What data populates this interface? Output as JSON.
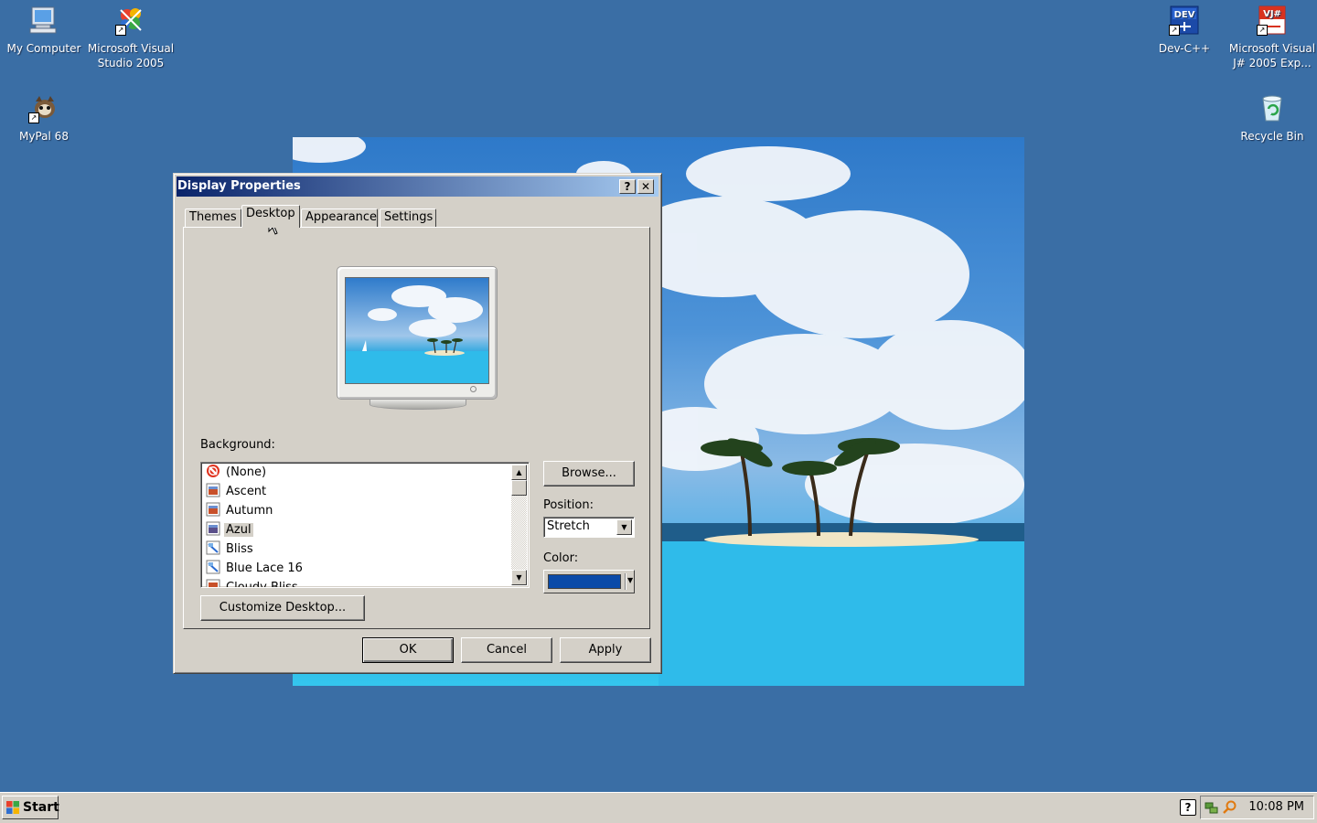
{
  "desktop": {
    "icons_left": [
      {
        "label": "My Computer",
        "icon": "my-computer-icon"
      },
      {
        "label": "Microsoft Visual Studio 2005",
        "icon": "visual-studio-icon"
      },
      {
        "label": "MyPal 68",
        "icon": "mypal-icon"
      }
    ],
    "icons_right": [
      {
        "label": "Dev-C++",
        "icon": "devcpp-icon",
        "badge": "DEV"
      },
      {
        "label": "Microsoft Visual J# 2005 Exp...",
        "icon": "visual-jsharp-icon",
        "badge": "VJ#"
      },
      {
        "label": "Recycle Bin",
        "icon": "recycle-bin-icon"
      }
    ]
  },
  "dialog": {
    "title": "Display Properties",
    "help_btn": "?",
    "close_btn": "✕",
    "tabs": [
      "Themes",
      "Desktop",
      "Appearance",
      "Settings"
    ],
    "active_tab": "Desktop",
    "background_label": "Background:",
    "backgrounds": [
      "(None)",
      "Ascent",
      "Autumn",
      "Azul",
      "Bliss",
      "Blue Lace 16",
      "Cloudy Bliss"
    ],
    "selected_background": "Azul",
    "browse_btn": "Browse...",
    "position_label": "Position:",
    "position_value": "Stretch",
    "color_label": "Color:",
    "color_value": "#0a4aa8",
    "customize_btn": "Customize Desktop...",
    "ok_btn": "OK",
    "cancel_btn": "Cancel",
    "apply_btn": "Apply"
  },
  "taskbar": {
    "start_label": "Start",
    "clock": "10:08 PM",
    "tray_icons": [
      "help-icon",
      "network-icon",
      "search-icon"
    ]
  },
  "colors": {
    "desktop_bg": "#3a6ea5",
    "titlebar_start": "#0a246a",
    "titlebar_end": "#a6caf0",
    "face": "#d4d0c8"
  }
}
